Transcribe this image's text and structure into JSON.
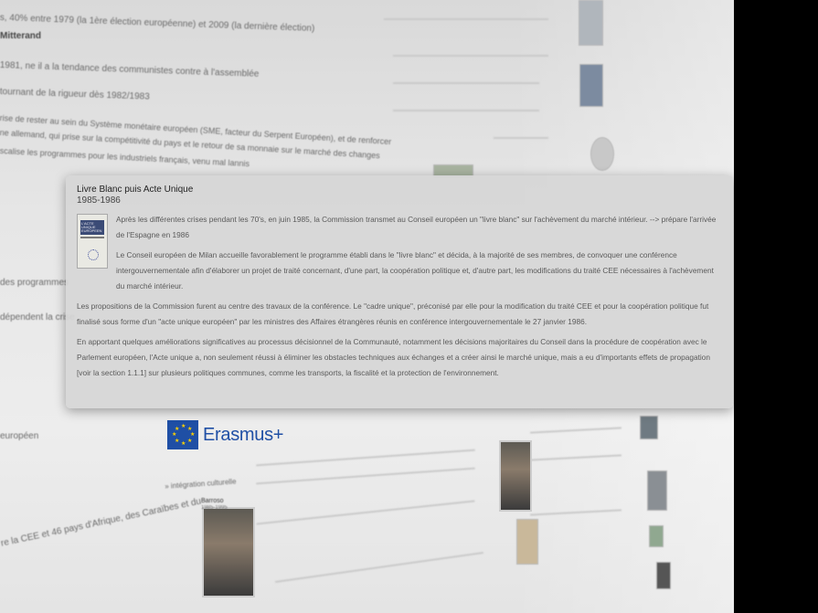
{
  "popup": {
    "title": "Livre Blanc puis Acte Unique",
    "years": "1985-1986",
    "paragraphs": [
      "Après les différentes crises pendant les 70's, en juin 1985, la Commission transmet au Conseil européen un \"livre blanc\" sur l'achèvement du marché intérieur. --> prépare l'arrivée de l'Espagne en 1986",
      "Le Conseil européen de Milan accueille favorablement le programme établi dans le \"livre blanc\" et décida, à la majorité de ses membres, de convoquer une conférence intergouvernementale afin d'élaborer un projet de traité concernant, d'une part, la coopération politique et, d'autre part, les modifications du traité CEE nécessaires à l'achèvement du marché intérieur.",
      "Les propositions de la Commission furent au centre des travaux de la conférence. Le \"cadre unique\", préconisé par elle pour la modification du traité CEE et pour la coopération politique fut finalisé sous forme d'un \"acte unique européen\" par les ministres des Affaires étrangères réunis en conférence intergouvernementale le 27 janvier 1986.",
      "En apportant quelques améliorations significatives au processus décisionnel de la Communauté, notamment les décisions majoritaires du Conseil dans la procédure de coopération avec le Parlement européen, l'Acte unique a, non seulement réussi à éliminer les obstacles techniques aux échanges et a créer ainsi le marché unique, mais a eu d'importants effets de propagation [voir la section 1.1.1] sur plusieurs politiques communes, comme les transports, la fiscalité et la protection de l'environnement."
    ],
    "book_cover_text": "L'ACTE UNIQUE EUROPEEN"
  },
  "background": {
    "erasmus_label": "Erasmus+",
    "blurred_lines": [
      "s, 40% entre 1979 (la 1ère élection européenne) et 2009 (la dernière élection)",
      "Mitterand",
      "1981, ne il a la tendance des communistes contre à l'assemblée",
      "tournant de la rigueur dès 1982/1983",
      "rise de rester au sein du Système monétaire européen (SME, facteur du Serpent Européen), et de renforcer",
      "ne allemand, qui prise sur la compétitivité du pays et le retour de sa monnaie sur le marché des changes",
      "scalise les programmes pour les industriels français, venu mal lannis",
      "des programmes",
      "dépendent la crise",
      "européen",
      "re la CEE et 46 pays d'Afrique, des Caraïbes et du",
      "» intégration culturelle"
    ],
    "portrait_caption": "Barroso",
    "small_caption": "1985-1995"
  },
  "colors": {
    "popup_bg": "#d6d6d6",
    "erasmus_blue": "#1f4fa5",
    "wall": "#e6e6e6"
  }
}
